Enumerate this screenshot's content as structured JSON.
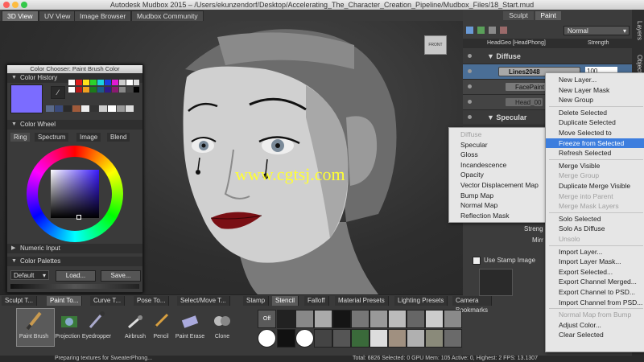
{
  "window": {
    "title": "Autodesk Mudbox 2015 – /Users/ekunzendorf/Desktop/Accelerating_The_Character_Creation_Pipeline/Mudbox_Files/18_Start.mud"
  },
  "view_tabs": [
    "3D View",
    "UV View",
    "Image Browser",
    "Mudbox Community"
  ],
  "viewport": {
    "view_cube_label": "FRONT",
    "watermark": "www.cgtsj.com"
  },
  "color_chooser": {
    "title": "Color Chooser: Paint Brush Color",
    "history_label": "Color History",
    "wheel_label": "Color Wheel",
    "tabs": [
      "Ring",
      "Spectrum",
      "Image",
      "Blend"
    ],
    "numeric_label": "Numeric Input",
    "palettes_label": "Color Palettes",
    "palette_select": "Default",
    "load_button": "Load...",
    "save_button": "Save...",
    "current_color": "#7b6cff"
  },
  "right_panel": {
    "tabs": [
      "Sculpt",
      "Paint"
    ],
    "blend_mode": "Normal",
    "header_layer": "HeadGeo [HeadPhong]",
    "header_strength": "Strength",
    "diffuse_label": "Diffuse",
    "layers": [
      "Lines2048",
      "FacePaint",
      "Head_00"
    ],
    "strength_value": "100",
    "specular_label": "Specular",
    "strength_label": "Streng",
    "mirror_label": "Mirr",
    "stamp_label": "Use Stamp Image"
  },
  "side_tabs": [
    "Layers",
    "Object List"
  ],
  "channel_menu": {
    "items": [
      {
        "label": "Diffuse",
        "disabled": true
      },
      {
        "label": "Specular",
        "disabled": false
      },
      {
        "label": "Gloss",
        "disabled": false
      },
      {
        "label": "Incandescence",
        "disabled": false
      },
      {
        "label": "Opacity",
        "disabled": false
      },
      {
        "label": "Vector Displacement Map",
        "disabled": false
      },
      {
        "label": "Bump Map",
        "disabled": false
      },
      {
        "label": "Normal Map",
        "disabled": false
      },
      {
        "label": "Reflection Mask",
        "disabled": false
      }
    ]
  },
  "layer_menu": {
    "items": [
      {
        "label": "New Layer...",
        "state": "normal"
      },
      {
        "label": "New Layer Mask",
        "state": "normal"
      },
      {
        "label": "New Group",
        "state": "normal"
      },
      {
        "sep": true
      },
      {
        "label": "Delete Selected",
        "state": "normal"
      },
      {
        "label": "Duplicate Selected",
        "state": "normal"
      },
      {
        "label": "Move Selected to",
        "state": "normal"
      },
      {
        "label": "Freeze from Selected",
        "state": "selected"
      },
      {
        "label": "Refresh Selected",
        "state": "normal"
      },
      {
        "sep": true
      },
      {
        "label": "Merge Visible",
        "state": "normal"
      },
      {
        "label": "Merge Group",
        "state": "disabled"
      },
      {
        "label": "Duplicate Merge Visible",
        "state": "normal"
      },
      {
        "label": "Merge into Parent",
        "state": "disabled"
      },
      {
        "label": "Merge Mask Layers",
        "state": "disabled"
      },
      {
        "sep": true
      },
      {
        "label": "Solo Selected",
        "state": "normal"
      },
      {
        "label": "Solo As Diffuse",
        "state": "normal"
      },
      {
        "label": "Unsolo",
        "state": "disabled"
      },
      {
        "sep": true
      },
      {
        "label": "Import Layer...",
        "state": "normal"
      },
      {
        "label": "Import Layer Mask...",
        "state": "normal"
      },
      {
        "label": "Export Selected...",
        "state": "normal"
      },
      {
        "label": "Export Channel Merged...",
        "state": "normal"
      },
      {
        "label": "Export Channel to PSD...",
        "state": "normal"
      },
      {
        "label": "Import Channel from PSD...",
        "state": "normal"
      },
      {
        "sep": true
      },
      {
        "label": "Normal Map from Bump",
        "state": "disabled"
      },
      {
        "label": "Adjust Color...",
        "state": "normal"
      },
      {
        "label": "Clear Selected",
        "state": "normal"
      }
    ]
  },
  "tool_tabs": [
    "Sculpt T...",
    "Paint To...",
    "Curve T...",
    "Pose To...",
    "Select/Move T..."
  ],
  "paint_tools": [
    "Paint Brush",
    "Projection",
    "Eyedropper",
    "Airbrush",
    "Pencil",
    "Paint Erase",
    "Clone"
  ],
  "tray_tabs": [
    "Stamp",
    "Stencil",
    "Falloff",
    "Material Presets",
    "Lighting Presets",
    "Camera Bookmarks"
  ],
  "stencil_off": "Off",
  "status": {
    "message": "Preparing textures for SweaterPhong...",
    "stats": "Total: 6826  Selected: 0  GPU Mem: 105  Active: 0, Highest: 2  FPS: 13.1307"
  }
}
